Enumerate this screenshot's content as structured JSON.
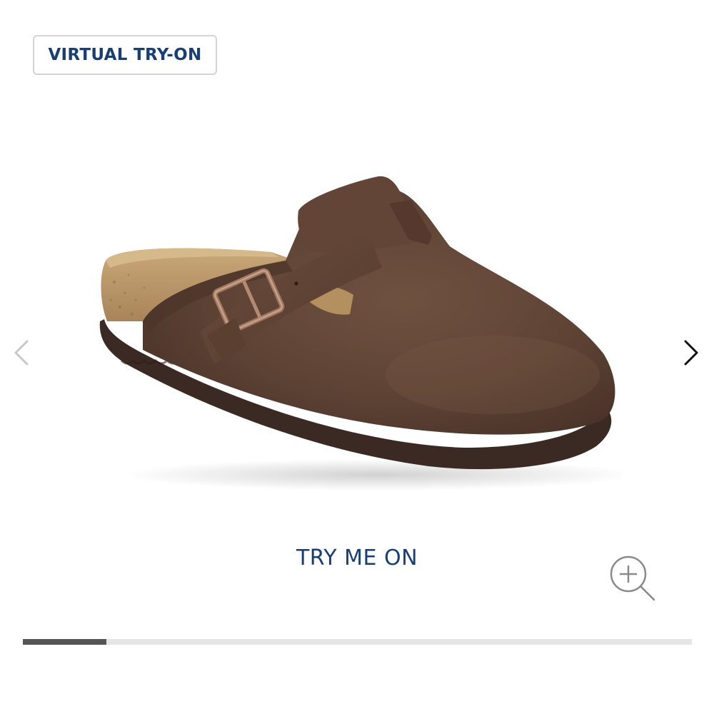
{
  "header": {
    "virtual_try_on_label": "VIRTUAL TRY-ON"
  },
  "gallery": {
    "image_alt": "Brown leather clog with adjustable buckle strap and cork footbed",
    "prev_icon": "chevron-left-icon",
    "next_icon": "chevron-right-icon",
    "zoom_icon": "zoom-in-icon",
    "cta_label": "TRY ME ON",
    "progress_fraction": 0.125
  },
  "colors": {
    "brand_blue": "#173f75",
    "progress_fill": "#555555",
    "progress_track": "#e5e5e5",
    "leather": "#5e4335",
    "sole": "#3b2a24",
    "cork": "#b99567"
  }
}
